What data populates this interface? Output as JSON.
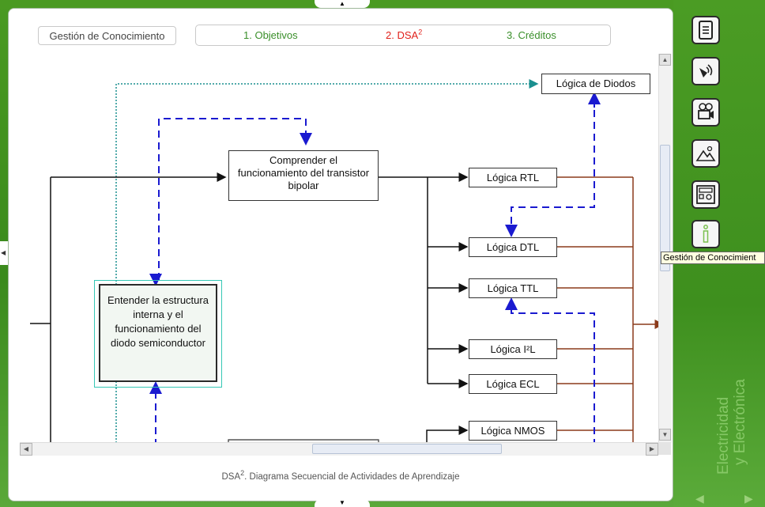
{
  "header": {
    "brand_label": "Gestión de Conocimiento",
    "tabs": [
      {
        "label": "1. Objetivos"
      },
      {
        "label": "2. DSA",
        "sup": "2"
      },
      {
        "label": "3. Créditos"
      }
    ]
  },
  "diagram": {
    "nodes": {
      "logica_diodos": "Lógica de Diodos",
      "comprender": "Comprender el funcionamiento  del transistor bipolar",
      "entender": "Entender la estructura interna y el funcionamiento del diodo semiconductor",
      "rtl": "Lógica RTL",
      "dtl": "Lógica DTL",
      "ttl": "Lógica TTL",
      "i2l": "Lógica I²L",
      "ecl": "Lógica ECL",
      "nmos": "Lógica NMOS"
    }
  },
  "caption": {
    "prefix": "DSA",
    "sup": "2",
    "text": ". Diagrama Secuencial de Actividades de Aprendizaje"
  },
  "sidebar": {
    "icons": [
      "document-icon",
      "audio-icon",
      "video-camera-icon",
      "image-icon",
      "calculator-icon",
      "info-icon"
    ],
    "tooltip": "Gestión de Conocimient"
  },
  "branding": {
    "vertical_text_1": "Electricidad",
    "vertical_text_2": "y Electrónica"
  },
  "colors": {
    "accent_green": "#3a8f2a",
    "active_tab": "#e0201a",
    "background_green": "#3d8d1f",
    "dashed_blue": "#1a1ad0",
    "dotted_teal": "#1a8f8f",
    "brown_line": "#8b3a1a"
  }
}
